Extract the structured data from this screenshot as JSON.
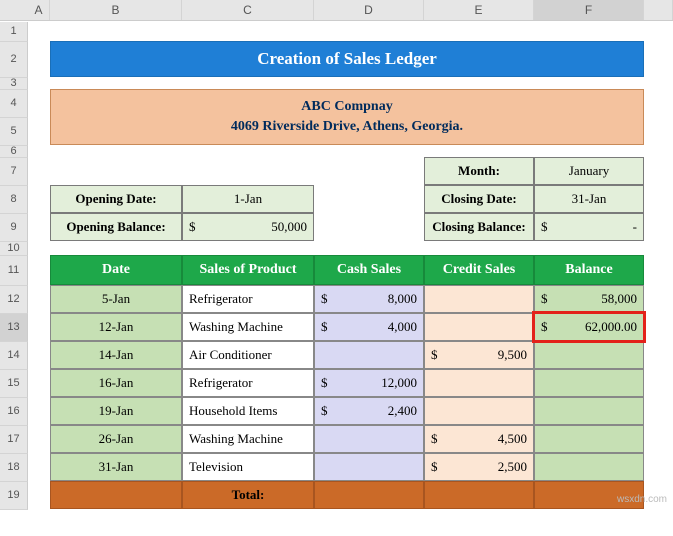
{
  "cols": [
    "A",
    "B",
    "C",
    "D",
    "E",
    "F"
  ],
  "rows": [
    "1",
    "2",
    "3",
    "4",
    "5",
    "6",
    "7",
    "8",
    "9",
    "10",
    "11",
    "12",
    "13",
    "14",
    "15",
    "16",
    "17",
    "18",
    "19"
  ],
  "selected_col": "F",
  "selected_row": "13",
  "title": "Creation of Sales Ledger",
  "company": {
    "name": "ABC Compnay",
    "addr": "4069 Riverside Drive, Athens, Georgia."
  },
  "left_block": {
    "od_label": "Opening Date:",
    "od_value": "1-Jan",
    "ob_label": "Opening Balance:",
    "ob_curr": "$",
    "ob_value": "50,000"
  },
  "right_block": {
    "m_label": "Month:",
    "m_value": "January",
    "cd_label": "Closing Date:",
    "cd_value": "31-Jan",
    "cb_label": "Closing Balance:",
    "cb_curr": "$",
    "cb_value": "-"
  },
  "headers": {
    "date": "Date",
    "prod": "Sales of Product",
    "cash": "Cash Sales",
    "credit": "Credit Sales",
    "bal": "Balance"
  },
  "rows_data": [
    {
      "date": "5-Jan",
      "prod": "Refrigerator",
      "cash": "8,000",
      "credit": "",
      "bal": "58,000",
      "bal_fmt": "int"
    },
    {
      "date": "12-Jan",
      "prod": "Washing Machine",
      "cash": "4,000",
      "credit": "",
      "bal": "62,000.00",
      "bal_fmt": "dec",
      "hl": true
    },
    {
      "date": "14-Jan",
      "prod": "Air Conditioner",
      "cash": "",
      "credit": "9,500",
      "bal": ""
    },
    {
      "date": "16-Jan",
      "prod": "Refrigerator",
      "cash": "12,000",
      "credit": "",
      "bal": ""
    },
    {
      "date": "19-Jan",
      "prod": "Household Items",
      "cash": "2,400",
      "credit": "",
      "bal": ""
    },
    {
      "date": "26-Jan",
      "prod": "Washing Machine",
      "cash": "",
      "credit": "4,500",
      "bal": ""
    },
    {
      "date": "31-Jan",
      "prod": "Television",
      "cash": "",
      "credit": "2,500",
      "bal": ""
    }
  ],
  "total_label": "Total:",
  "watermark": "wsxdn.com"
}
